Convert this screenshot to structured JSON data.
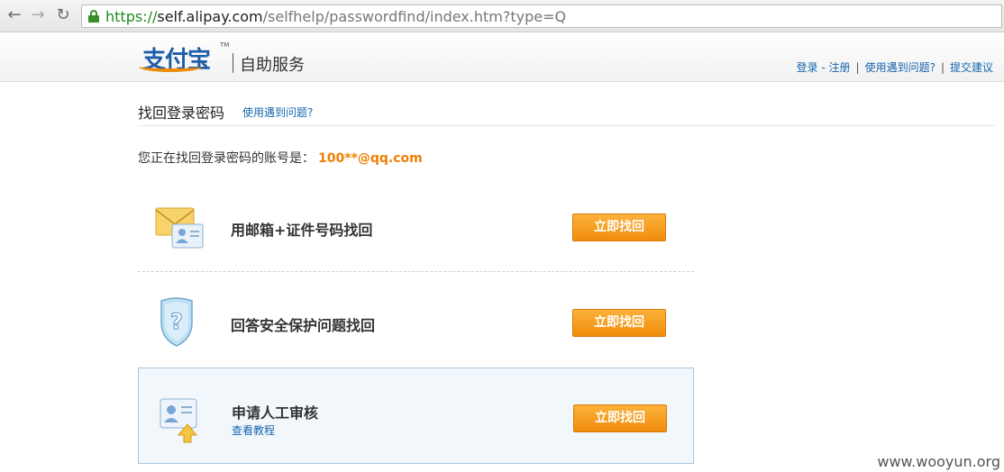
{
  "browser": {
    "url_scheme": "https://",
    "url_host": "self.alipay.com",
    "url_path": "/selfhelp/passwordfind/index.htm?type=Q",
    "back_icon": "back-arrow-icon",
    "forward_icon": "forward-arrow-icon",
    "reload_icon": "reload-icon"
  },
  "header": {
    "logo_text": "支付宝",
    "logo_tm": "TM",
    "title": "自助服务",
    "links": [
      "登录 - 注册",
      "使用遇到问题?",
      "提交建议"
    ]
  },
  "main": {
    "page_title": "找回登录密码",
    "help_link": "使用遇到问题?",
    "account_prefix": "您正在找回登录密码的账号是：",
    "account": "100**@qq.com",
    "options": [
      {
        "label": "用邮箱+证件号码找回",
        "button": "立即找回",
        "icon": "email-id-card-icon"
      },
      {
        "label": "回答安全保护问题找回",
        "button": "立即找回",
        "icon": "security-question-shield-icon"
      },
      {
        "label": "申请人工审核",
        "sub_link": "查看教程",
        "button": "立即找回",
        "icon": "manual-review-id-card-icon"
      }
    ]
  },
  "watermark": "www.wooyun.org",
  "colors": {
    "accent": "#f08d0c",
    "link": "#1666ae",
    "account": "#f07f00"
  }
}
